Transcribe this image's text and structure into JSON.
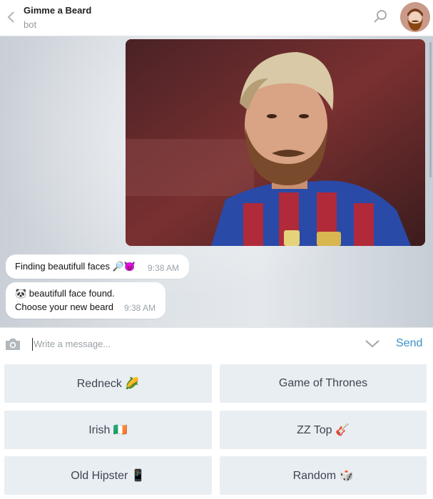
{
  "header": {
    "title": "Gimme a Beard",
    "subtitle": "bot",
    "back_icon": "chevron-left-icon",
    "search_icon": "search-icon",
    "avatar_icon": "beard-avatar-icon"
  },
  "chat": {
    "messages": [
      {
        "text": "Finding beautifull faces 🔎😈",
        "time": "9:38 AM"
      },
      {
        "line1": "🐼 beautifull face found.",
        "line2": "Choose your new beard",
        "time": "9:38 AM"
      }
    ]
  },
  "composer": {
    "placeholder": "Write a message...",
    "camera_icon": "camera-icon",
    "chevron_icon": "chevron-down-icon",
    "send_label": "Send",
    "colors": {
      "accent": "#3a92c9"
    }
  },
  "keyboard": {
    "buttons": [
      {
        "label": "Redneck 🌽"
      },
      {
        "label": "Game of Thrones"
      },
      {
        "label": "Irish 🇮🇪"
      },
      {
        "label": "ZZ Top 🎸"
      },
      {
        "label": "Old Hipster 📱"
      },
      {
        "label": "Random 🎲"
      }
    ]
  }
}
